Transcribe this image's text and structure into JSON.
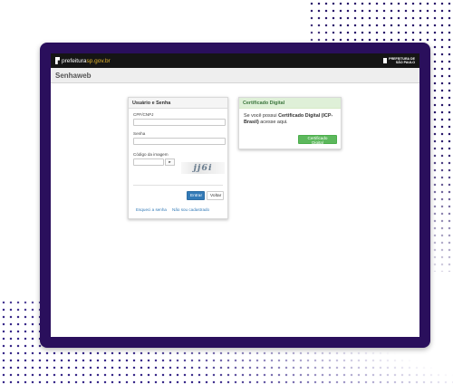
{
  "header": {
    "logo_text": "prefeitura",
    "logo_domain": "sp.gov.br",
    "brand_line1": "PREFEITURA DE",
    "brand_line2": "SÃO PAULO"
  },
  "site": {
    "title": "Senhaweb"
  },
  "login": {
    "panel_title": "Usuário e Senha",
    "cpf_label": "CPF/CNPJ",
    "cpf_value": "",
    "password_label": "Senha",
    "password_value": "",
    "captcha_label": "Código da imagem",
    "captcha_value": "",
    "captcha_text": "jj6i",
    "audio_icon": "speaker-icon",
    "submit_label": "Entrar",
    "back_label": "Voltar",
    "forgot_link": "Esqueci a senha",
    "register_link": "Não sou cadastrado"
  },
  "certificate": {
    "panel_title": "Certificado Digital",
    "text_prefix": "Se você possui ",
    "text_bold": "Certificado Digital (ICP-Brasil)",
    "text_suffix": " acesse aqui.",
    "button_label": "Certificado Digital"
  },
  "colors": {
    "frame": "#2a0f5c",
    "topbar": "#151515",
    "domain_accent": "#e8b92e",
    "primary_button": "#337ab7",
    "success_button": "#5cb85c",
    "success_header": "#dff0d8"
  }
}
